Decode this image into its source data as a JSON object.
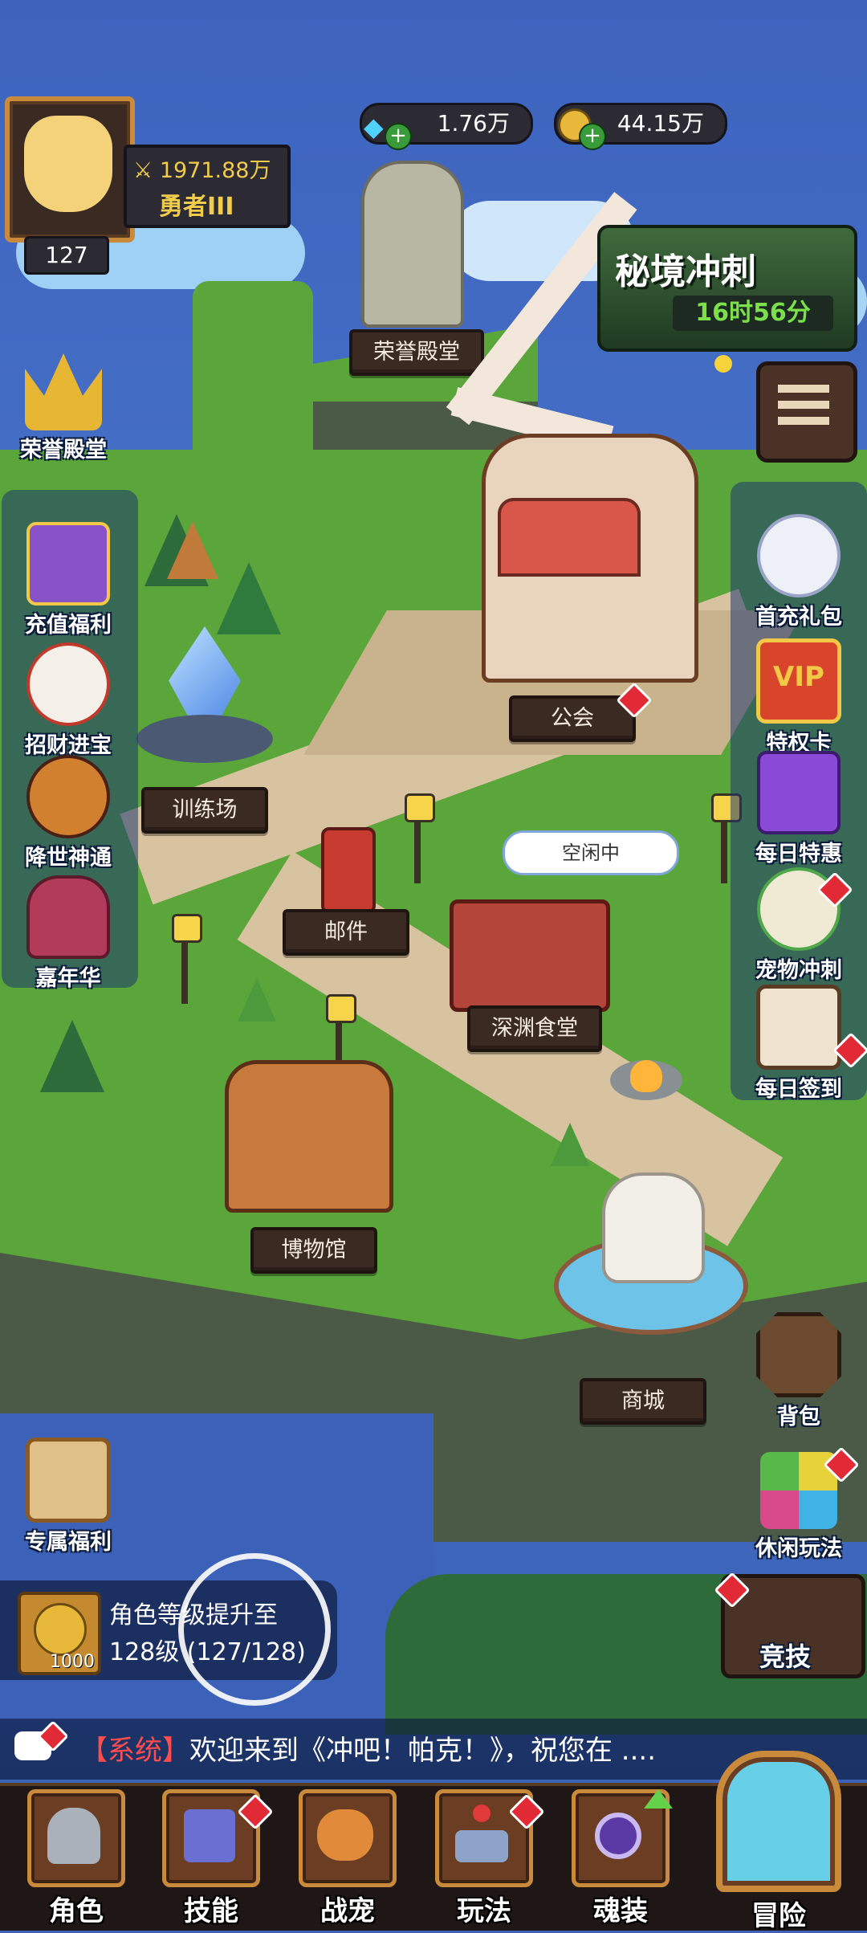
{
  "player": {
    "level": "127",
    "power": "1971.88万",
    "rank": "勇者III"
  },
  "currency": {
    "diamonds": "1.76万",
    "gold": "44.15万"
  },
  "event_banner": {
    "title": "秘境冲刺",
    "timer": "16时56分"
  },
  "map_labels": {
    "hall_of_honor": "荣誉殿堂",
    "guild": "公会",
    "training_ground": "训练场",
    "mail": "邮件",
    "idle_status": "空闲中",
    "abyss_canteen": "深渊食堂",
    "museum": "博物馆",
    "shop": "商城"
  },
  "left_menu": [
    {
      "label": "荣誉殿堂",
      "icon": "crown-icon"
    },
    {
      "label": "充值福利",
      "icon": "gift-chest-icon"
    },
    {
      "label": "招财进宝",
      "icon": "lucky-cat-icon"
    },
    {
      "label": "降世神通",
      "icon": "heroes-icon"
    },
    {
      "label": "嘉年华",
      "icon": "carnival-bag-icon"
    },
    {
      "label": "专属福利",
      "icon": "qr-scroll-icon"
    }
  ],
  "right_menu": [
    {
      "label": "首充礼包",
      "icon": "catgirl-icon"
    },
    {
      "label": "特权卡",
      "icon": "vip-card-icon"
    },
    {
      "label": "每日特惠",
      "icon": "purple-gift-icon"
    },
    {
      "label": "宠物冲刺",
      "icon": "pet-egg-icon"
    },
    {
      "label": "每日签到",
      "icon": "calendar-icon"
    },
    {
      "label": "背包",
      "icon": "backpack-icon"
    },
    {
      "label": "休闲玩法",
      "icon": "pinwheel-icon"
    },
    {
      "label": "竞技",
      "icon": "arena-icon"
    }
  ],
  "quest": {
    "title": "角色等级提升至",
    "detail": "128级 (127/128)",
    "reward": "1000"
  },
  "ticker": {
    "tag": "【系统】",
    "message": "欢迎来到《冲吧！帕克！》，祝您在 ...."
  },
  "bottom_tabs": [
    {
      "label": "角色"
    },
    {
      "label": "技能"
    },
    {
      "label": "战宠"
    },
    {
      "label": "玩法"
    },
    {
      "label": "魂装"
    },
    {
      "label": "冒险"
    }
  ],
  "colors": {
    "sky": "#3f63b8",
    "grass": "#5aa63b",
    "path": "#d8c3a0",
    "badge_red": "#e12a36",
    "timer_green": "#7be04a",
    "label_wood": "#3a2a22"
  }
}
